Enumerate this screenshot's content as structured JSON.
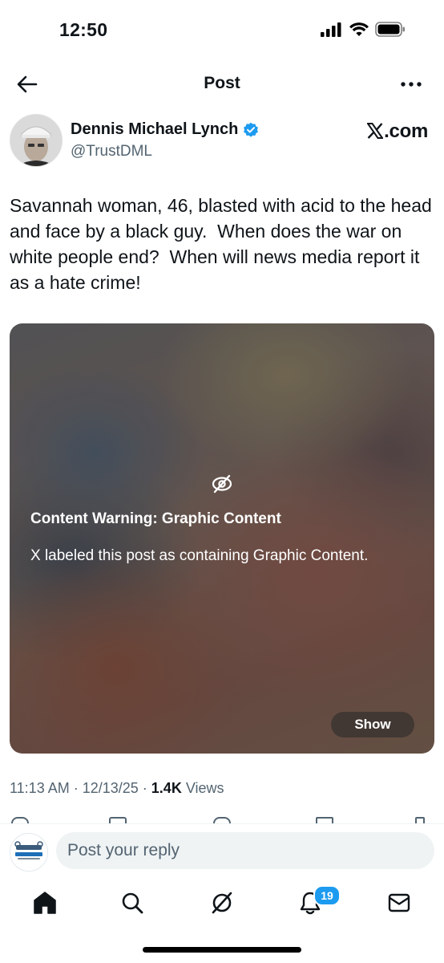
{
  "status_bar": {
    "time": "12:50"
  },
  "header": {
    "title": "Post"
  },
  "author": {
    "name": "Dennis Michael Lynch",
    "handle": "@TrustDML",
    "verified": true,
    "site_label": ".com"
  },
  "tweet": {
    "text": "Savannah woman, 46, blasted with acid to the head and face by a black guy.  When does the war on white people end?  When will news media report it as a hate crime!"
  },
  "media": {
    "warning_title": "Content Warning: Graphic Content",
    "warning_description": "X labeled this post as containing Graphic Content.",
    "show_label": "Show"
  },
  "meta": {
    "time": "11:13 AM",
    "separator": " · ",
    "date": "12/13/25",
    "views_count": "1.4K",
    "views_label": " Views"
  },
  "reply": {
    "placeholder": "Post your reply"
  },
  "tab_bar": {
    "notifications_badge": "19"
  },
  "colors": {
    "accent": "#1d9bf0",
    "text": "#0f1419",
    "secondary": "#536471"
  }
}
